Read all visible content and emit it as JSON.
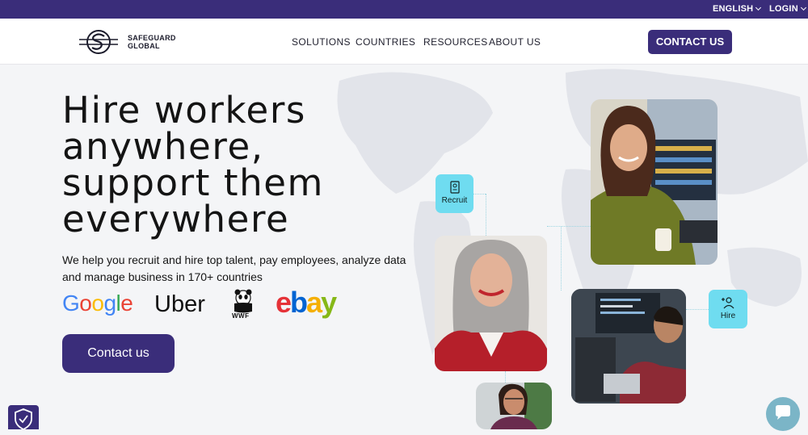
{
  "topbar": {
    "language": "ENGLISH",
    "login": "LOGIN"
  },
  "brand": {
    "name_line1": "SAFEGUARD",
    "name_line2": "GLOBAL"
  },
  "nav": {
    "items": [
      "SOLUTIONS",
      "COUNTRIES",
      "RESOURCES",
      "ABOUT US"
    ],
    "cta": "CONTACT US"
  },
  "hero": {
    "headline_lines": [
      "Hire workers",
      "anywhere,",
      "support them",
      "everywhere"
    ],
    "subtext": "We help you recruit and hire top talent, pay employees, analyze data and manage business in 170+ countries",
    "cta": "Contact us"
  },
  "clients": {
    "google": "Google",
    "uber": "Uber",
    "wwf": "WWF",
    "ebay": "ebay"
  },
  "badges": {
    "recruit": "Recruit",
    "hire": "Hire"
  },
  "colors": {
    "primary": "#3a2d7a",
    "badge": "#6fdcf0",
    "chat": "#7bb5c7"
  },
  "icons": [
    "chevron-down-icon",
    "document-icon",
    "add-user-icon",
    "shield-check-icon",
    "chat-icon"
  ]
}
